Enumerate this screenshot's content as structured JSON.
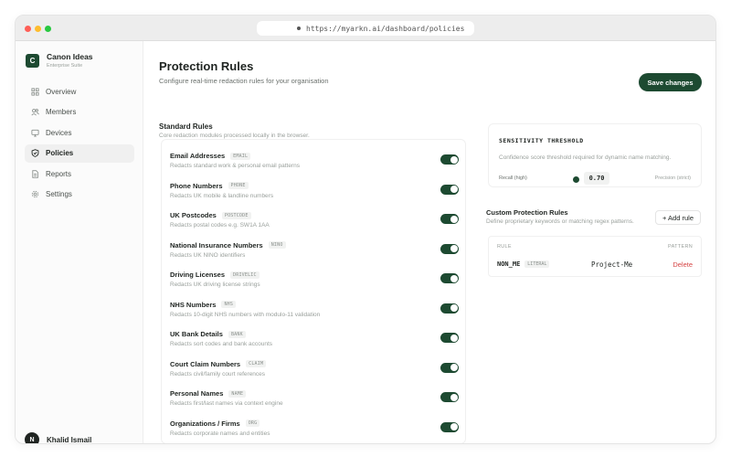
{
  "browser": {
    "url": "https://myarkn.ai/dashboard/policies"
  },
  "brand": {
    "logo_letter": "C",
    "name": "Canon Ideas",
    "subtitle": "Enterprise Suite"
  },
  "sidebar": {
    "items": [
      {
        "label": "Overview",
        "icon": "grid-icon",
        "active": false
      },
      {
        "label": "Members",
        "icon": "users-icon",
        "active": false
      },
      {
        "label": "Devices",
        "icon": "monitor-icon",
        "active": false
      },
      {
        "label": "Policies",
        "icon": "shield-icon",
        "active": true
      },
      {
        "label": "Reports",
        "icon": "document-icon",
        "active": false
      },
      {
        "label": "Settings",
        "icon": "gear-icon",
        "active": false
      }
    ]
  },
  "user": {
    "initial": "N",
    "name": "Khalid Ismail"
  },
  "header": {
    "title": "Protection Rules",
    "subtitle": "Configure real-time redaction rules for your organisation",
    "save_label": "Save changes"
  },
  "standard": {
    "title": "Standard Rules",
    "subtitle": "Core redaction modules processed locally in the browser.",
    "rules": [
      {
        "name": "Email Addresses",
        "tag": "EMAIL",
        "desc": "Redacts standard work & personal email patterns",
        "enabled": true
      },
      {
        "name": "Phone Numbers",
        "tag": "PHONE",
        "desc": "Redacts UK mobile & landline numbers",
        "enabled": true
      },
      {
        "name": "UK Postcodes",
        "tag": "POSTCODE",
        "desc": "Redacts postal codes e.g. SW1A 1AA",
        "enabled": true
      },
      {
        "name": "National Insurance Numbers",
        "tag": "NINO",
        "desc": "Redacts UK NINO identifiers",
        "enabled": true
      },
      {
        "name": "Driving Licenses",
        "tag": "DRIVELIC",
        "desc": "Redacts UK driving license strings",
        "enabled": true
      },
      {
        "name": "NHS Numbers",
        "tag": "NHS",
        "desc": "Redacts 10-digit NHS numbers with modulo-11 validation",
        "enabled": true
      },
      {
        "name": "UK Bank Details",
        "tag": "BANK",
        "desc": "Redacts sort codes and bank accounts",
        "enabled": true
      },
      {
        "name": "Court Claim Numbers",
        "tag": "CLAIM",
        "desc": "Redacts civil/family court references",
        "enabled": true
      },
      {
        "name": "Personal Names",
        "tag": "NAME",
        "desc": "Redacts first/last names via context engine",
        "enabled": true
      },
      {
        "name": "Organizations / Firms",
        "tag": "ORG",
        "desc": "Redacts corporate names and entities",
        "enabled": true
      }
    ]
  },
  "threshold": {
    "title": "SENSITIVITY THRESHOLD",
    "desc": "Confidence score threshold required for dynamic name matching.",
    "left_label": "Recall (high)",
    "right_label": "Precision (strict)",
    "value": "0.70"
  },
  "custom": {
    "title": "Custom Protection Rules",
    "subtitle": "Define proprietary keywords or matching regex patterns.",
    "add_label": "+ Add rule",
    "col_rule": "RULE",
    "col_pattern": "PATTERN",
    "rows": [
      {
        "name": "NON_ME",
        "tag": "LITERAL",
        "pattern": "Project-Me",
        "delete_label": "Delete"
      }
    ]
  },
  "colors": {
    "accent": "#1d4a31",
    "danger": "#d64545",
    "muted": "#9aa09c"
  }
}
